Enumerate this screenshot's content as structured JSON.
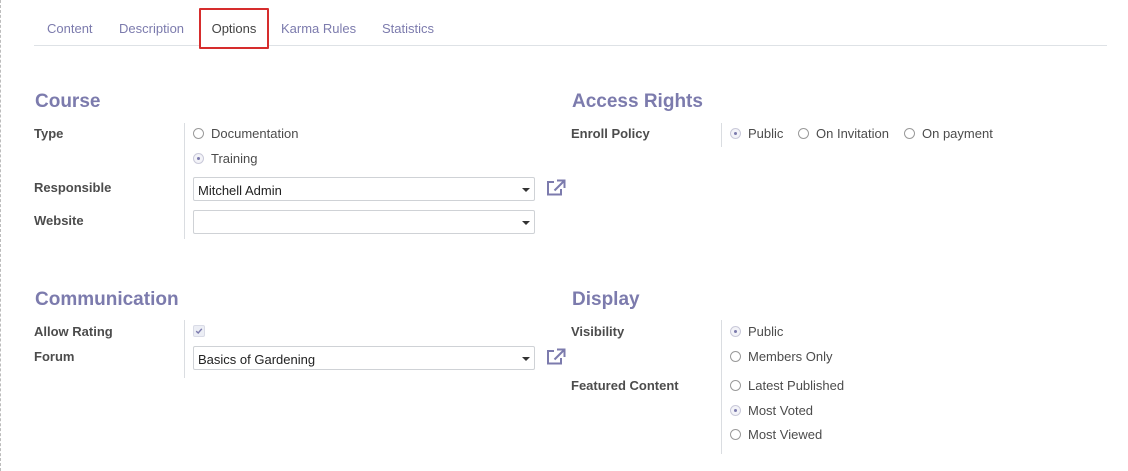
{
  "tabs": [
    {
      "label": "Content",
      "active": false
    },
    {
      "label": "Description",
      "active": false
    },
    {
      "label": "Options",
      "active": true
    },
    {
      "label": "Karma Rules",
      "active": false
    },
    {
      "label": "Statistics",
      "active": false
    }
  ],
  "course": {
    "title": "Course",
    "type_label": "Type",
    "type_options": [
      {
        "label": "Documentation",
        "checked": false
      },
      {
        "label": "Training",
        "checked": true
      }
    ],
    "responsible_label": "Responsible",
    "responsible_value": "Mitchell Admin",
    "website_label": "Website",
    "website_value": ""
  },
  "access_rights": {
    "title": "Access Rights",
    "enroll_label": "Enroll Policy",
    "enroll_options": [
      {
        "label": "Public",
        "checked": true
      },
      {
        "label": "On Invitation",
        "checked": false
      },
      {
        "label": "On payment",
        "checked": false
      }
    ]
  },
  "communication": {
    "title": "Communication",
    "allow_rating_label": "Allow Rating",
    "allow_rating_checked": true,
    "forum_label": "Forum",
    "forum_value": "Basics of Gardening"
  },
  "display": {
    "title": "Display",
    "visibility_label": "Visibility",
    "visibility_options": [
      {
        "label": "Public",
        "checked": true
      },
      {
        "label": "Members Only",
        "checked": false
      }
    ],
    "featured_label": "Featured Content",
    "featured_options": [
      {
        "label": "Latest Published",
        "checked": false
      },
      {
        "label": "Most Voted",
        "checked": true
      },
      {
        "label": "Most Viewed",
        "checked": false
      }
    ]
  },
  "colors": {
    "accent": "#7c7bad",
    "active_tab_border": "#d62d2d"
  },
  "icons": {
    "external_link": "external-link-icon",
    "caret": "caret-down-icon",
    "check": "check-icon"
  }
}
